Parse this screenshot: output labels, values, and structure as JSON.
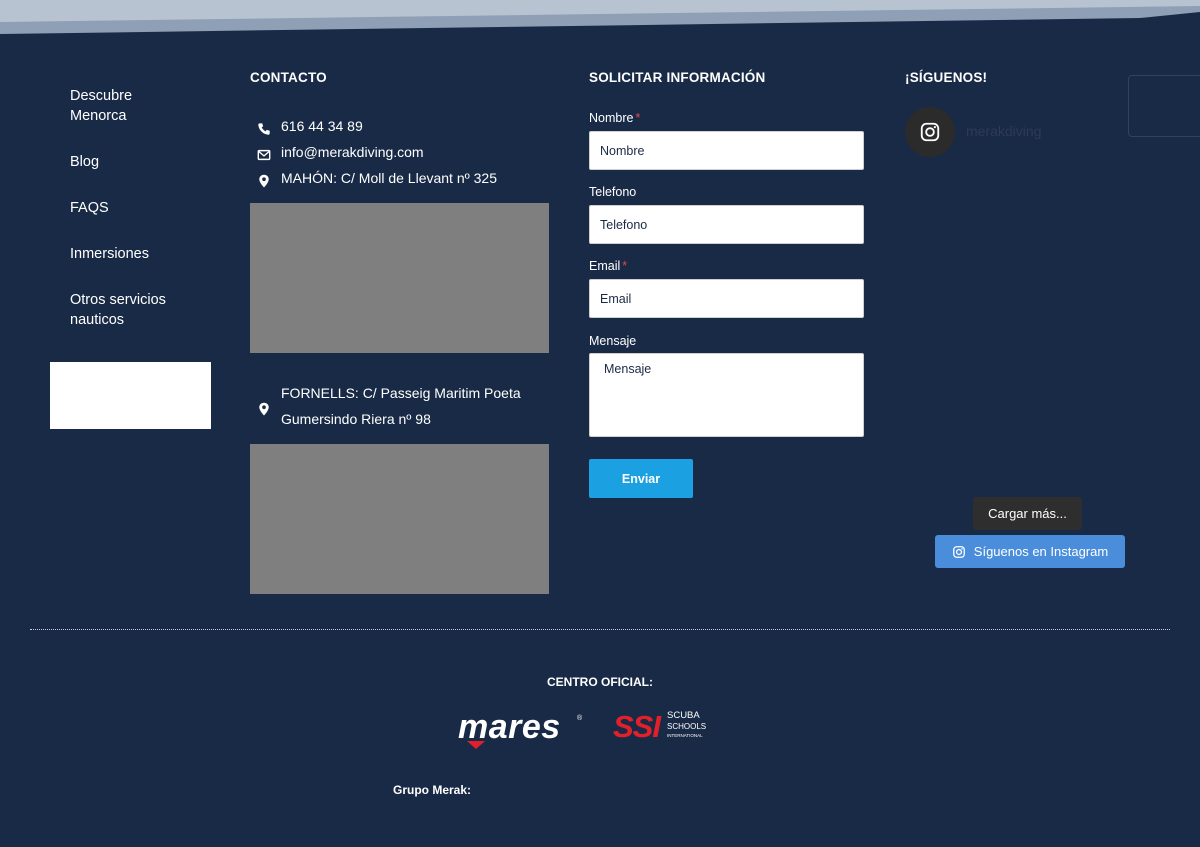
{
  "nav": {
    "items": [
      {
        "label": "Descubre Menorca"
      },
      {
        "label": "Blog"
      },
      {
        "label": "FAQS"
      },
      {
        "label": "Inmersiones"
      },
      {
        "label": "Otros servicios nauticos"
      }
    ]
  },
  "contact": {
    "title": "CONTACTO",
    "phone": "616 44 34 89",
    "email": "info@merakdiving.com",
    "address_mahon": "MAHÓN: C/ Moll de Llevant nº 325",
    "address_fornells_line1": "FORNELLS: C/ Passeig Maritim Poeta",
    "address_fornells_line2": "Gumersindo Riera nº 98"
  },
  "form": {
    "title": "SOLICITAR INFORMACIÓN",
    "name_label": "Nombre",
    "name_placeholder": "Nombre",
    "phone_label": "Telefono",
    "phone_placeholder": "Telefono",
    "email_label": "Email",
    "email_placeholder": "Email",
    "message_label": "Mensaje",
    "message_placeholder": "Mensaje",
    "required_mark": "*",
    "submit_label": "Enviar"
  },
  "social": {
    "title": "¡SÍGUENOS!",
    "handle": "merakdiving",
    "load_more_label": "Cargar más...",
    "follow_label": "Síguenos en Instagram"
  },
  "footer": {
    "official_center_label": "CENTRO OFICIAL:",
    "brand_mares": "mares",
    "brand_mares_reg": "®",
    "brand_ssi_mark": "SSI",
    "brand_ssi_line1": "SCUBA",
    "brand_ssi_line2": "SCHOOLS",
    "brand_ssi_line3": "INTERNATIONAL",
    "group_label": "Grupo Merak:"
  },
  "colors": {
    "background": "#192a46",
    "button_blue": "#1ba0e2",
    "instagram_blue": "#4a8edb",
    "required_red": "#e5464c",
    "map_gray": "#7f7f7f"
  }
}
